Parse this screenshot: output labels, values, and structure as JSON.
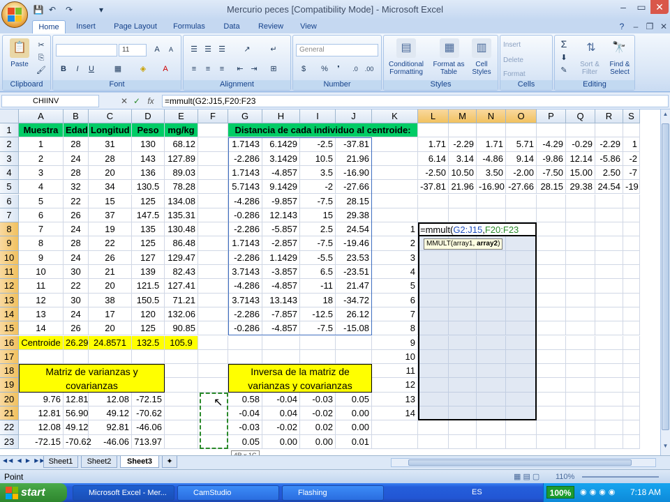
{
  "window": {
    "title": "Mercurio peces  [Compatibility Mode] - Microsoft Excel",
    "controls": [
      "–",
      "▭",
      "✕"
    ],
    "doc_controls": [
      "–",
      "❐",
      "✕"
    ]
  },
  "qat": [
    "💾",
    "↶",
    "↷",
    "▾"
  ],
  "ribbon_tabs": [
    "Home",
    "Insert",
    "Page Layout",
    "Formulas",
    "Data",
    "Review",
    "View"
  ],
  "ribbon": {
    "clipboard": {
      "label": "Clipboard",
      "paste": "Paste"
    },
    "font": {
      "label": "Font",
      "font_size": "11",
      "bold": "B",
      "italic": "I",
      "underline": "U"
    },
    "alignment": {
      "label": "Alignment"
    },
    "number": {
      "label": "Number",
      "format": "General",
      "currency": "$",
      "percent": "%",
      "comma": "❜"
    },
    "styles": {
      "label": "Styles",
      "conditional": "Conditional Formatting",
      "format_table": "Format as Table",
      "cell_styles": "Cell Styles"
    },
    "cells": {
      "label": "Cells",
      "insert": "Insert",
      "delete": "Delete",
      "format": "Format"
    },
    "editing": {
      "label": "Editing",
      "sigma": "Σ",
      "sort_filter": "Sort & Filter",
      "find_select": "Find & Select"
    }
  },
  "formula_bar": {
    "name_box": "CHIINV",
    "formula": "=mmult(G2:J15,F20:F23"
  },
  "columns": [
    "A",
    "B",
    "C",
    "D",
    "E",
    "F",
    "G",
    "H",
    "I",
    "J",
    "K",
    "L",
    "M",
    "N",
    "O",
    "P",
    "Q",
    "R",
    "S"
  ],
  "rows": [
    "1",
    "2",
    "3",
    "4",
    "5",
    "6",
    "7",
    "8",
    "9",
    "10",
    "11",
    "12",
    "13",
    "14",
    "15",
    "16",
    "17",
    "18",
    "19",
    "20",
    "21",
    "22",
    "23"
  ],
  "sheet": {
    "headers": [
      "Muestra",
      "Edad",
      "Longitud",
      "Peso",
      "mg/kg"
    ],
    "data": [
      [
        "1",
        "28",
        "31",
        "130",
        "68.12"
      ],
      [
        "2",
        "24",
        "28",
        "143",
        "127.89"
      ],
      [
        "3",
        "28",
        "20",
        "136",
        "89.03"
      ],
      [
        "4",
        "32",
        "34",
        "130.5",
        "78.28"
      ],
      [
        "5",
        "22",
        "15",
        "125",
        "134.08"
      ],
      [
        "6",
        "26",
        "37",
        "147.5",
        "135.31"
      ],
      [
        "7",
        "24",
        "19",
        "135",
        "130.48"
      ],
      [
        "8",
        "28",
        "22",
        "125",
        "86.48"
      ],
      [
        "9",
        "24",
        "26",
        "127",
        "129.47"
      ],
      [
        "10",
        "30",
        "21",
        "139",
        "82.43"
      ],
      [
        "11",
        "22",
        "20",
        "121.5",
        "127.41"
      ],
      [
        "12",
        "30",
        "38",
        "150.5",
        "71.21"
      ],
      [
        "13",
        "24",
        "17",
        "120",
        "132.06"
      ],
      [
        "14",
        "26",
        "20",
        "125",
        "90.85"
      ]
    ],
    "centroide": [
      "Centroide",
      "26.29",
      "24.8571",
      "132.5",
      "105.9"
    ],
    "dist_title": "Distancia de cada individuo al centroide:",
    "dist": [
      [
        "1.7143",
        "6.1429",
        "-2.5",
        "-37.81"
      ],
      [
        "-2.286",
        "3.1429",
        "10.5",
        "21.96"
      ],
      [
        "1.7143",
        "-4.857",
        "3.5",
        "-16.90"
      ],
      [
        "5.7143",
        "9.1429",
        "-2",
        "-27.66"
      ],
      [
        "-4.286",
        "-9.857",
        "-7.5",
        "28.15"
      ],
      [
        "-0.286",
        "12.143",
        "15",
        "29.38"
      ],
      [
        "-2.286",
        "-5.857",
        "2.5",
        "24.54"
      ],
      [
        "1.7143",
        "-2.857",
        "-7.5",
        "-19.46"
      ],
      [
        "-2.286",
        "1.1429",
        "-5.5",
        "23.53"
      ],
      [
        "3.7143",
        "-3.857",
        "6.5",
        "-23.51"
      ],
      [
        "-4.286",
        "-4.857",
        "-11",
        "21.47"
      ],
      [
        "3.7143",
        "13.143",
        "18",
        "-34.72"
      ],
      [
        "-2.286",
        "-7.857",
        "-12.5",
        "26.12"
      ],
      [
        "-0.286",
        "-4.857",
        "-7.5",
        "-15.08"
      ]
    ],
    "transpose": [
      [
        "1.71",
        "-2.29",
        "1.71",
        "5.71",
        "-4.29",
        "-0.29",
        "-2.29",
        "1"
      ],
      [
        "6.14",
        "3.14",
        "-4.86",
        "9.14",
        "-9.86",
        "12.14",
        "-5.86",
        "-2"
      ],
      [
        "-2.50",
        "10.50",
        "3.50",
        "-2.00",
        "-7.50",
        "15.00",
        "2.50",
        "-7"
      ],
      [
        "-37.81",
        "21.96",
        "-16.90",
        "-27.66",
        "28.15",
        "29.38",
        "24.54",
        "-19"
      ]
    ],
    "k_index": [
      "1",
      "2",
      "3",
      "4",
      "5",
      "6",
      "7",
      "8",
      "9",
      "10",
      "11",
      "12",
      "13",
      "14"
    ],
    "editing_formula_prefix": "=mmult(",
    "editing_ref1": "G2:J15",
    "editing_sep": ",",
    "editing_ref2": "F20:F23",
    "tooltip_fn": "MMULT(array1, ",
    "tooltip_arg": "array2",
    "tooltip_close": ")",
    "varcov_title": "Matriz de varianzas y covarianzas",
    "varcov": [
      [
        "9.76",
        "12.81",
        "12.08",
        "-72.15"
      ],
      [
        "12.81",
        "56.90",
        "49.12",
        "-70.62"
      ],
      [
        "12.08",
        "49.12",
        "92.81",
        "-46.06"
      ],
      [
        "-72.15",
        "-70.62",
        "-46.06",
        "713.97"
      ]
    ],
    "inv_title": "Inversa de la matriz de varianzas y covarianzas",
    "inv": [
      [
        "0.58",
        "-0.04",
        "-0.03",
        "0.05"
      ],
      [
        "-0.04",
        "0.04",
        "-0.02",
        "0.00"
      ],
      [
        "-0.03",
        "-0.02",
        "0.02",
        "0.00"
      ],
      [
        "0.05",
        "0.00",
        "0.00",
        "0.01"
      ]
    ],
    "size_tip": "4R x 1C"
  },
  "sheet_tabs": [
    "Sheet1",
    "Sheet2",
    "Sheet3"
  ],
  "status": {
    "mode": "Point",
    "zoom": "110%"
  },
  "taskbar": {
    "start": "start",
    "tasks": [
      "Microsoft Excel - Mer...",
      "CamStudio",
      "Flashing"
    ],
    "lang": "ES",
    "zoom_badge": "100%",
    "clock": "7:18 AM"
  },
  "colors": {
    "yellow": "#ffff00",
    "green_header": "#00cc66",
    "selection_border": "#3f6ec0"
  }
}
